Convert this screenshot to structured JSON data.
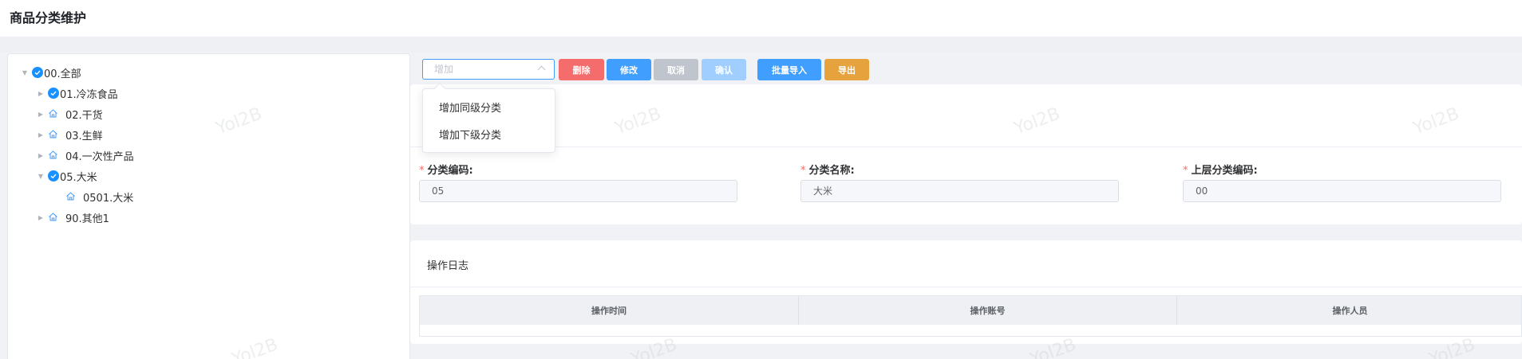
{
  "header": {
    "title": "商品分类维护"
  },
  "tree": [
    {
      "label": "00.全部",
      "level": 0,
      "expanded": true,
      "checked": true
    },
    {
      "label": "01.冷冻食品",
      "level": 1,
      "expanded": false,
      "checked": true
    },
    {
      "label": "02.干货",
      "level": 1,
      "expanded": false,
      "checked": false
    },
    {
      "label": "03.生鲜",
      "level": 1,
      "expanded": false,
      "checked": false
    },
    {
      "label": "04.一次性产品",
      "level": 1,
      "expanded": false,
      "checked": false
    },
    {
      "label": "05.大米",
      "level": 1,
      "expanded": true,
      "checked": true
    },
    {
      "label": "0501.大米",
      "level": 2,
      "expanded": false,
      "checked": false
    },
    {
      "label": "90.其他1",
      "level": 1,
      "expanded": false,
      "checked": false
    }
  ],
  "toolbar": {
    "select_placeholder": "增加",
    "delete_label": "删除",
    "edit_label": "修改",
    "cancel_label": "取消",
    "confirm_label": "确认",
    "import_label": "批量导入",
    "export_label": "导出"
  },
  "dropdown": {
    "items": [
      "增加同级分类",
      "增加下级分类"
    ]
  },
  "form": {
    "code_label": "分类编码:",
    "code_value": "05",
    "name_label": "分类名称:",
    "name_value": "大米",
    "parent_label": "上层分类编码:",
    "parent_value": "00"
  },
  "log": {
    "title": "操作日志",
    "columns": [
      "操作时间",
      "操作账号",
      "操作人员"
    ]
  },
  "watermark_text": "Yol2B",
  "colors": {
    "primary": "#409eff",
    "danger": "#f56c6c",
    "disabled": "#c0c4cc",
    "disabled_primary": "#a0cfff",
    "warning": "#e6a23c"
  }
}
